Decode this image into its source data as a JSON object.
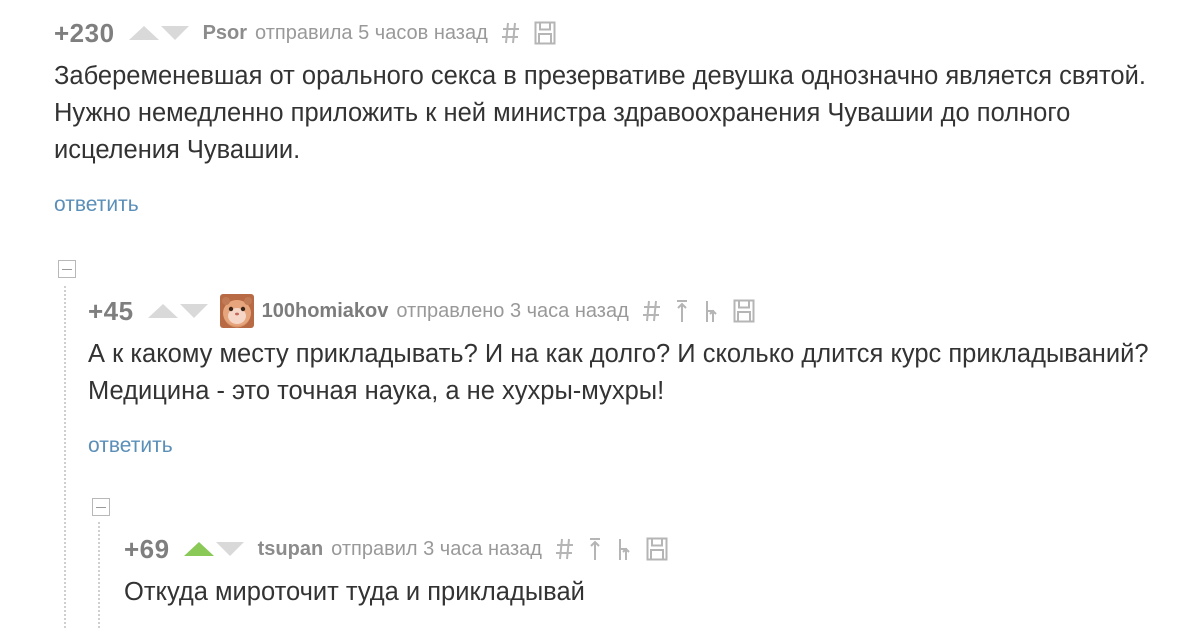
{
  "comments": [
    {
      "rating": "+230",
      "author": "Psor",
      "sent": "отправила 5 часов назад",
      "text": "Забеременевшая от орального секса в презервативе девушка однозначно является святой. Нужно немедленно приложить к ней министра здравоохранения Чувашии до полного исцеления Чувашии.",
      "reply": "ответить"
    },
    {
      "rating": "+45",
      "author": "100homiakov",
      "sent": "отправлено 3 часа назад",
      "text": "А к какому месту прикладывать? И на как долго? И сколько длится курс прикладываний? Медицина - это точная наука, а не хухры-мухры!",
      "reply": "ответить"
    },
    {
      "rating": "+69",
      "author": "tsupan",
      "sent": "отправил 3 часа назад",
      "text": "Откуда мироточит туда и прикладывай"
    }
  ],
  "icons": {
    "vote_up": "triangle-up-icon",
    "vote_down": "triangle-down-icon",
    "permalink": "hash-icon",
    "parent": "arrow-up-icon",
    "branch": "branch-icon",
    "save": "floppy-disk-icon",
    "collapse": "minus-box-icon"
  },
  "colors": {
    "vote_active": "#8ac858",
    "vote_inactive": "#d9d9d9",
    "link": "#5b8fb8"
  }
}
